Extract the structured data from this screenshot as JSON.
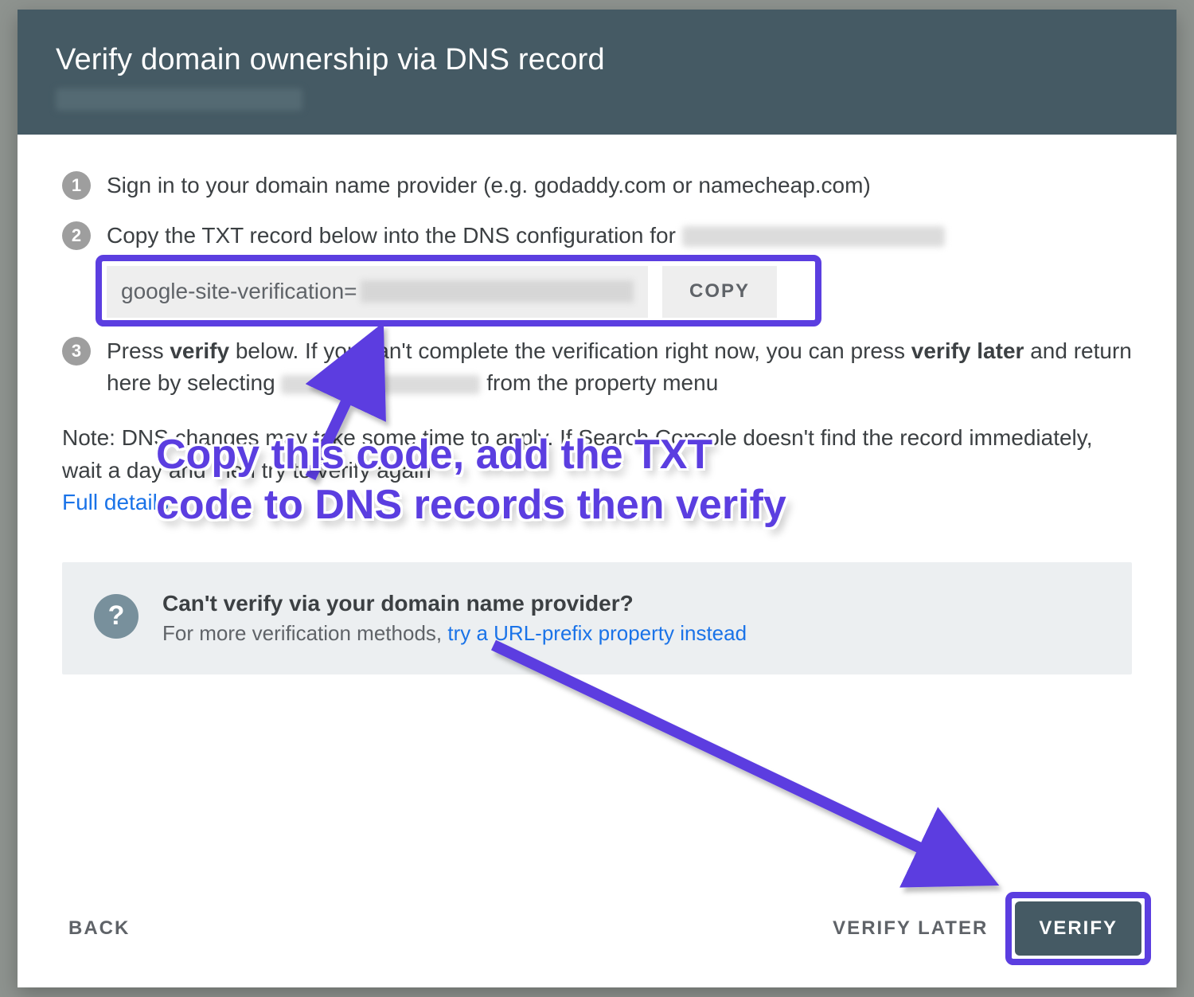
{
  "header": {
    "title": "Verify domain ownership via DNS record"
  },
  "steps": {
    "s1": "Sign in to your domain name provider (e.g. godaddy.com or namecheap.com)",
    "s2_prefix": "Copy the TXT record below into the DNS configuration for ",
    "txt_value_prefix": "google-site-verification=",
    "copy_label": "COPY",
    "s3_a": "Press ",
    "s3_verify": "verify",
    "s3_b": " below. If you can't complete the verification right now, you can press ",
    "s3_verify_later1": "verify later",
    "s3_c": " and return here by selecting ",
    "s3_d": " from the property menu"
  },
  "note": {
    "line1": "Note: DNS changes may take some time to apply. If Search Console doesn't find the record immediately, wait a day and then try to verify again",
    "link": "Full details"
  },
  "hint": {
    "title": "Can't verify via your domain name provider?",
    "sub_prefix": "For more verification methods, ",
    "sub_link": "try a URL-prefix property instead"
  },
  "actions": {
    "back": "BACK",
    "verify_later": "VERIFY LATER",
    "verify": "VERIFY"
  },
  "annotation": {
    "text": "Copy this code, add the TXT code to DNS records then verify"
  }
}
